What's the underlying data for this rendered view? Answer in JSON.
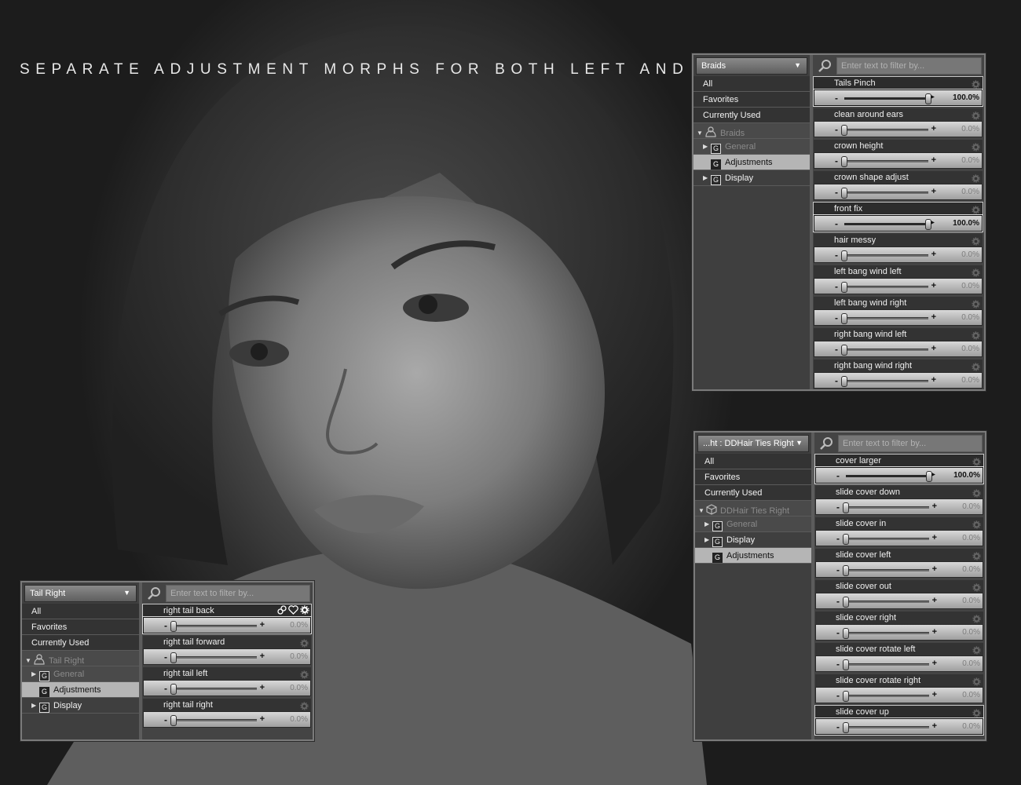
{
  "headline": "SEPARATE ADJUSTMENT MORPHS FOR BOTH LEFT AND RIGHT",
  "search_placeholder": "Enter text to filter by...",
  "panels": {
    "braids": {
      "dropdown": "Braids",
      "categories": [
        {
          "label": "All"
        },
        {
          "label": "Favorites"
        },
        {
          "label": "Currently Used"
        },
        {
          "label": "Braids"
        },
        {
          "label": "General"
        },
        {
          "label": "Adjustments"
        },
        {
          "label": "Display"
        }
      ],
      "props": [
        {
          "name": "Tails Pinch",
          "value": "100.0%",
          "fraction": 1.0
        },
        {
          "name": "clean around ears",
          "value": "0.0%",
          "fraction": 0.0
        },
        {
          "name": "crown height",
          "value": "0.0%",
          "fraction": 0.0
        },
        {
          "name": "crown shape adjust",
          "value": "0.0%",
          "fraction": 0.0
        },
        {
          "name": "front fix",
          "value": "100.0%",
          "fraction": 1.0
        },
        {
          "name": "hair messy",
          "value": "0.0%",
          "fraction": 0.0
        },
        {
          "name": "left bang wind left",
          "value": "0.0%",
          "fraction": 0.0
        },
        {
          "name": "left bang wind right",
          "value": "0.0%",
          "fraction": 0.0
        },
        {
          "name": "right bang wind left",
          "value": "0.0%",
          "fraction": 0.0
        },
        {
          "name": "right bang wind right",
          "value": "0.0%",
          "fraction": 0.0
        }
      ]
    },
    "ties": {
      "dropdown": "...ht : DDHair Ties Right",
      "categories": [
        {
          "label": "All"
        },
        {
          "label": "Favorites"
        },
        {
          "label": "Currently Used"
        },
        {
          "label": "DDHair Ties Right"
        },
        {
          "label": "General"
        },
        {
          "label": "Display"
        },
        {
          "label": "Adjustments"
        }
      ],
      "props": [
        {
          "name": "cover larger",
          "value": "100.0%",
          "fraction": 1.0
        },
        {
          "name": "slide cover down",
          "value": "0.0%",
          "fraction": 0.0
        },
        {
          "name": "slide cover in",
          "value": "0.0%",
          "fraction": 0.0
        },
        {
          "name": "slide cover left",
          "value": "0.0%",
          "fraction": 0.0
        },
        {
          "name": "slide cover out",
          "value": "0.0%",
          "fraction": 0.0
        },
        {
          "name": "slide cover right",
          "value": "0.0%",
          "fraction": 0.0
        },
        {
          "name": "slide cover rotate left",
          "value": "0.0%",
          "fraction": 0.0
        },
        {
          "name": "slide cover rotate right",
          "value": "0.0%",
          "fraction": 0.0
        },
        {
          "name": "slide cover up",
          "value": "0.0%",
          "fraction": 0.0
        }
      ]
    },
    "tail": {
      "dropdown": "Tail Right",
      "categories": [
        {
          "label": "All"
        },
        {
          "label": "Favorites"
        },
        {
          "label": "Currently Used"
        },
        {
          "label": "Tail Right"
        },
        {
          "label": "General"
        },
        {
          "label": "Adjustments"
        },
        {
          "label": "Display"
        }
      ],
      "props": [
        {
          "name": "right tail back",
          "value": "0.0%",
          "fraction": 0.0
        },
        {
          "name": "right tail forward",
          "value": "0.0%",
          "fraction": 0.0
        },
        {
          "name": "right tail left",
          "value": "0.0%",
          "fraction": 0.0
        },
        {
          "name": "right tail right",
          "value": "0.0%",
          "fraction": 0.0
        }
      ]
    }
  }
}
